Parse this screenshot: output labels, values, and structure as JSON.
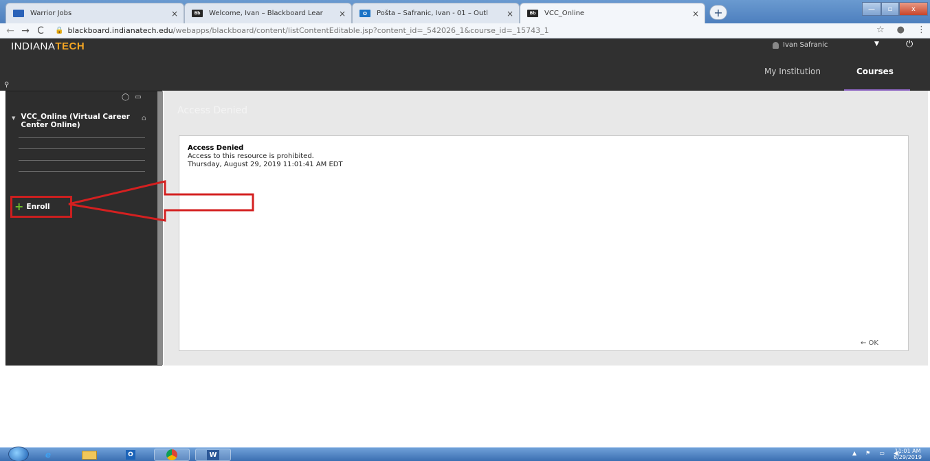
{
  "browser": {
    "tabs": [
      {
        "title": "Warrior Jobs",
        "favicon": "warrior-jobs-favicon",
        "close": "×"
      },
      {
        "title": "Welcome, Ivan – Blackboard Lear",
        "favicon": "blackboard-favicon",
        "favicon_text": "Bb",
        "close": "×"
      },
      {
        "title": "Pošta – Šafranic, Ivan - 01 – Outl",
        "favicon": "outlook-favicon",
        "favicon_text": "O",
        "close": "×"
      },
      {
        "title": "VCC_Online",
        "favicon": "blackboard-favicon",
        "favicon_text": "Bb",
        "close": "×"
      }
    ],
    "new_tab": "+",
    "url_host": "blackboard.indianatech.edu",
    "url_path": "/webapps/blackboard/content/listContentEditable.jsp?content_id=_542026_1&course_id=_15743_1",
    "nav": {
      "back": "←",
      "forward": "→",
      "reload": "C",
      "lock": "🔒"
    },
    "addr_icons": {
      "star": "☆",
      "profile": "●",
      "menu": "⋮"
    },
    "window_controls": {
      "minimize": "—",
      "maximize": "▫",
      "close": "x"
    }
  },
  "header": {
    "logo_part1": "INDIANA",
    "logo_part2": "TECH",
    "user_name": "Ivan Safranic",
    "user_caret": "▼",
    "power_icon": "⏻",
    "pin_icon": "⚲",
    "nav": {
      "my_institution": "My Institution",
      "courses": "Courses"
    },
    "accent_color": "#8e66c4"
  },
  "sidebar": {
    "tools": {
      "refresh": "◯",
      "folder": "▭"
    },
    "course_arrow": "▼",
    "course_title": "VCC_Online (Virtual Career Center Online)",
    "home_icon": "⌂",
    "enroll_plus": "+",
    "enroll_label": "Enroll",
    "highlight_color": "#cc1f1f"
  },
  "main": {
    "page_heading": "Access Denied",
    "message_title": "Access Denied",
    "message_text": "Access to this resource is prohibited.",
    "message_time": "Thursday, August 29, 2019 11:01:41 AM EDT",
    "ok_link": "← OK"
  },
  "taskbar": {
    "ie_label": "e",
    "outlook_label": "O",
    "word_label": "W",
    "tray_icons": {
      "arrow": "▲",
      "flag": "⚑",
      "network": "▭",
      "volume": "◀)"
    },
    "clock_time": "11:01 AM",
    "clock_date": "8/29/2019"
  }
}
